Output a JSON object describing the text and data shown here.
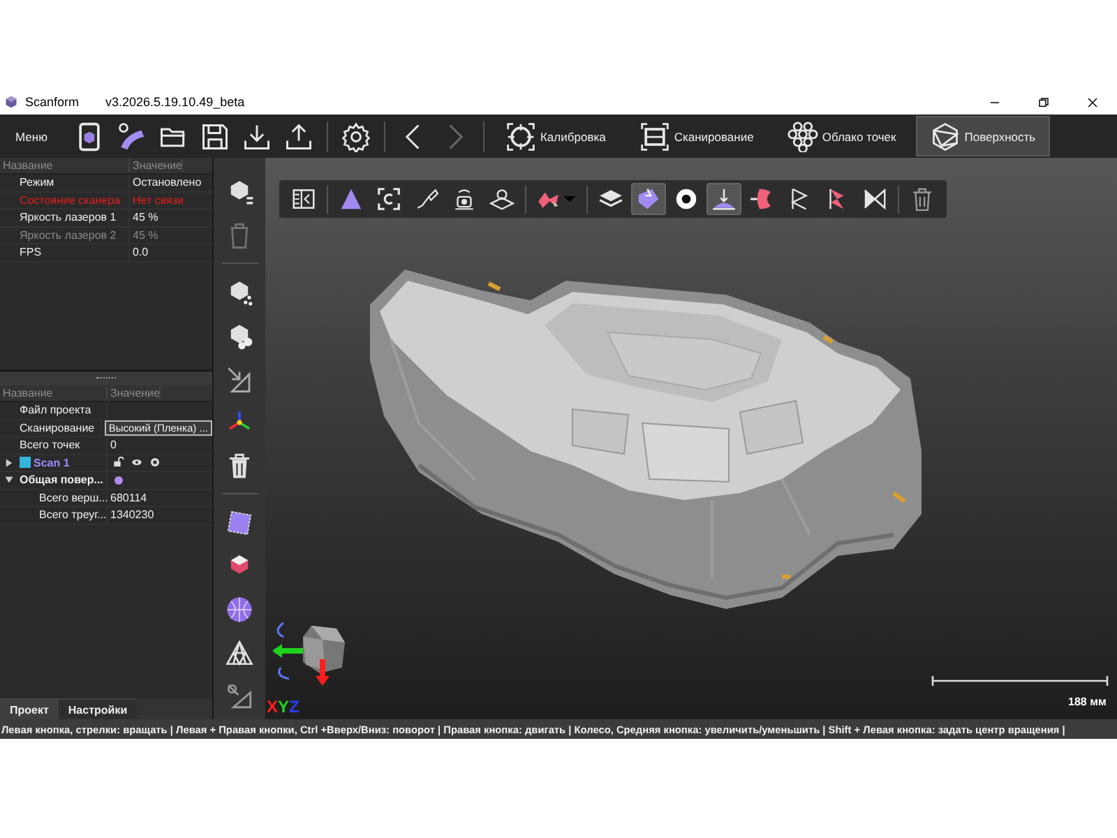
{
  "window": {
    "app_name": "Scanform",
    "version": "v3.2026.5.19.10.49_beta"
  },
  "toolbar": {
    "menu": "Меню",
    "history": [
      {
        "disabled": false
      },
      {
        "disabled": true
      }
    ],
    "modes": [
      {
        "label": "Калибровка",
        "selected": false
      },
      {
        "label": "Сканирование",
        "selected": false
      },
      {
        "label": "Облако точек",
        "selected": false
      },
      {
        "label": "Поверхность",
        "selected": true
      }
    ]
  },
  "status_table": {
    "columns": [
      "Название",
      "Значение"
    ],
    "rows": [
      {
        "kind": "normal",
        "name": "Режим",
        "value": "Остановлено"
      },
      {
        "kind": "error",
        "name": "Состояние сканера",
        "value": "Нет связи"
      },
      {
        "kind": "normal",
        "name": "Яркость лазеров 1",
        "value": "45 %"
      },
      {
        "kind": "disabled",
        "name": "Яркость лазеров 2",
        "value": "45 %"
      },
      {
        "kind": "normal",
        "name": "FPS",
        "value": "0.0"
      }
    ]
  },
  "project_table": {
    "columns": [
      "Название",
      "Значение"
    ],
    "rows": [
      {
        "kind": "field",
        "name": "Файл проекта"
      },
      {
        "kind": "dropdown",
        "name": "Сканирование",
        "value": "Высокий (Пленка) ..."
      },
      {
        "kind": "field",
        "name": "Всего точек",
        "value": "0"
      },
      {
        "kind": "scan",
        "name": "Scan 1",
        "color": "#35b4dd",
        "expanded": false
      },
      {
        "kind": "mesh",
        "name": "Общая повер...",
        "expanded": true,
        "children": [
          {
            "name": "Всего верш...",
            "value": "680114"
          },
          {
            "name": "Всего треуг...",
            "value": "1340230"
          }
        ]
      }
    ]
  },
  "tabs": [
    {
      "label": "Проект",
      "selected": true
    },
    {
      "label": "Настройки",
      "selected": false
    }
  ],
  "side_tools": [
    {
      "disabled": false
    },
    {
      "disabled": true
    },
    {
      "disabled": false
    },
    {
      "disabled": false
    },
    {
      "disabled": false
    },
    {
      "disabled": false
    },
    {
      "disabled": false
    },
    {
      "disabled": false
    },
    {
      "disabled": false
    },
    {
      "disabled": false
    },
    {
      "disabled": false
    },
    {
      "disabled": false
    }
  ],
  "view_tools": [
    [
      {
        "selected": false
      }
    ],
    [
      {
        "selected": false
      },
      {
        "selected": false
      },
      {
        "selected": false
      },
      {
        "selected": false
      },
      {
        "selected": false
      }
    ],
    [
      {
        "selected": false
      }
    ],
    [
      {
        "selected": false
      },
      {
        "selected": true
      },
      {
        "selected": false
      },
      {
        "selected": true
      },
      {
        "selected": false
      },
      {
        "selected": false
      },
      {
        "selected": false
      },
      {
        "selected": false
      }
    ],
    [
      {
        "selected": false
      }
    ]
  ],
  "axis_label": [
    {
      "text": "X",
      "color": "#ff1e1e"
    },
    {
      "text": "Y",
      "color": "#1ed21e"
    },
    {
      "text": "Z",
      "color": "#2e3cff"
    }
  ],
  "scale": {
    "label": "188 мм"
  },
  "status_bar": "Левая кнопка, стрелки: вращать | Левая + Правая кнопки, Ctrl +Вверх/Вниз: поворот | Правая кнопка: двигать | Колесо, Средняя кнопка: увеличить/уменьшить | Shift + Левая кнопка: задать центр вращения |"
}
